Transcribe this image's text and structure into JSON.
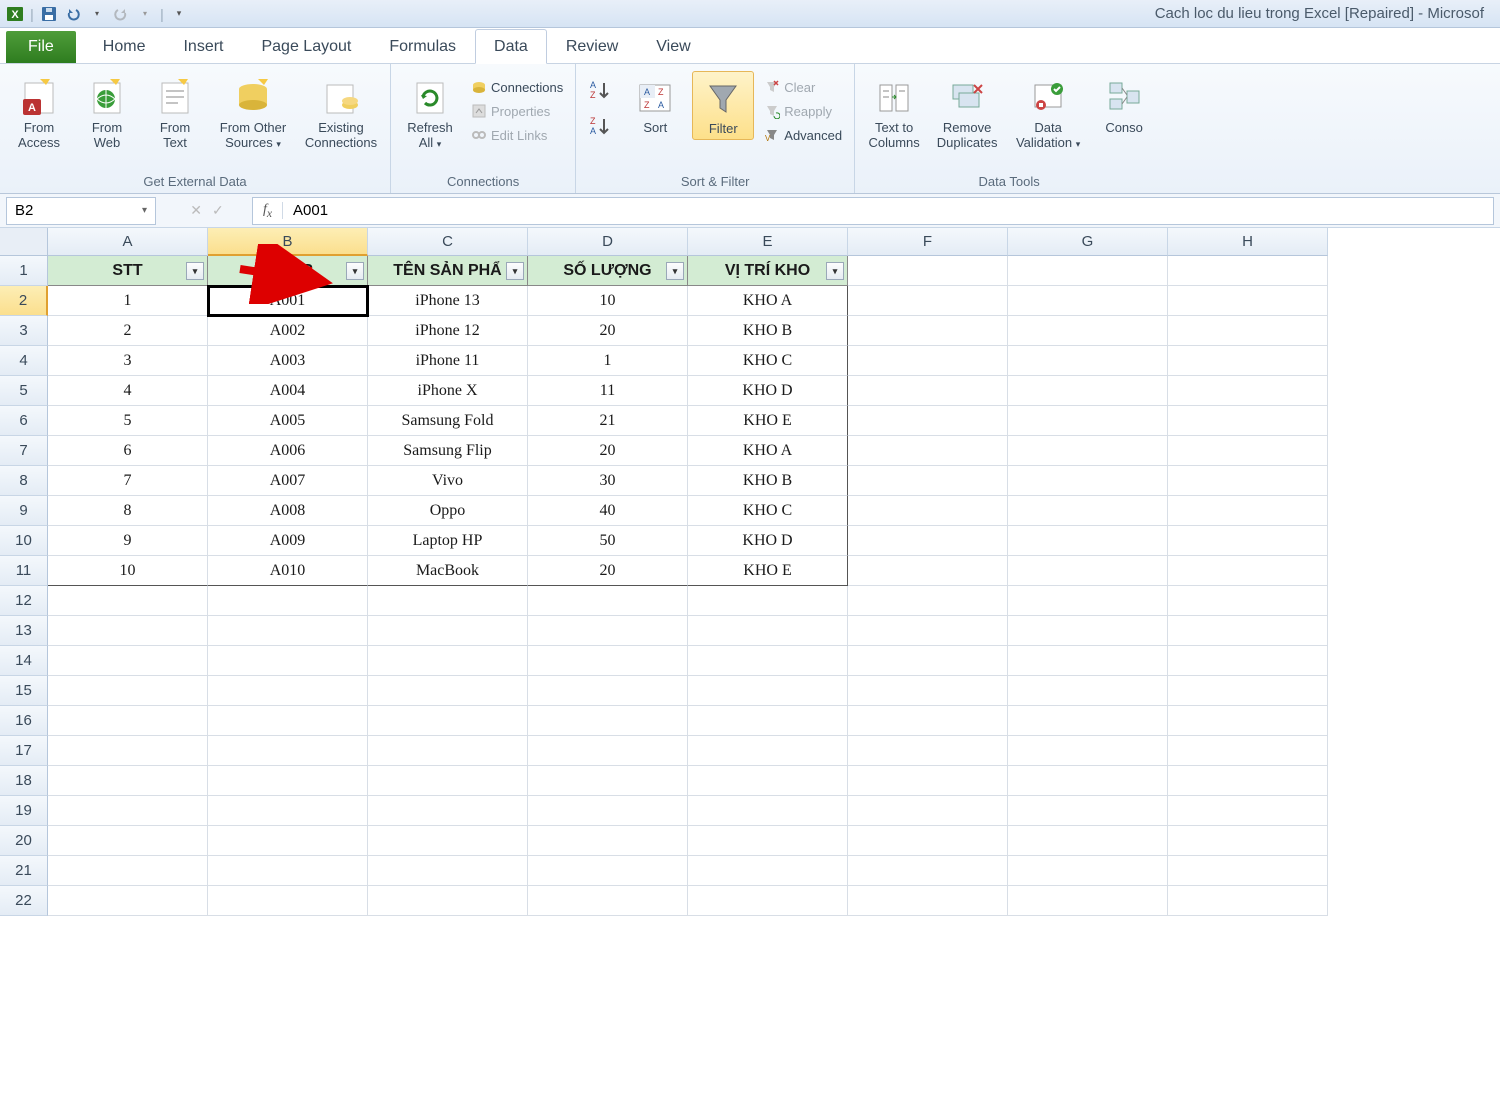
{
  "window_title": "Cach loc du lieu trong Excel [Repaired]  -  Microsof",
  "tabs": {
    "file": "File",
    "home": "Home",
    "insert": "Insert",
    "page_layout": "Page Layout",
    "formulas": "Formulas",
    "data": "Data",
    "review": "Review",
    "view": "View"
  },
  "ribbon": {
    "get_external": {
      "label": "Get External Data",
      "from_access": "From\nAccess",
      "from_web": "From\nWeb",
      "from_text": "From\nText",
      "from_other": "From Other\nSources",
      "existing": "Existing\nConnections"
    },
    "connections": {
      "label": "Connections",
      "refresh": "Refresh\nAll",
      "connections": "Connections",
      "properties": "Properties",
      "edit_links": "Edit Links"
    },
    "sort_filter": {
      "label": "Sort & Filter",
      "sort": "Sort",
      "filter": "Filter",
      "clear": "Clear",
      "reapply": "Reapply",
      "advanced": "Advanced"
    },
    "data_tools": {
      "label": "Data Tools",
      "text_to_cols": "Text to\nColumns",
      "remove_dup": "Remove\nDuplicates",
      "data_val": "Data\nValidation",
      "conso": "Conso"
    }
  },
  "namebox": "B2",
  "formula": "A001",
  "columns": [
    "A",
    "B",
    "C",
    "D",
    "E",
    "F",
    "G",
    "H"
  ],
  "selected_col_index": 1,
  "selected_row_index": 1,
  "visible_rows": 22,
  "table": {
    "headers": [
      "STT",
      "MÃ SP",
      "TÊN SẢN PHẨ",
      "SỐ LƯỢNG",
      "VỊ TRÍ KHO"
    ],
    "rows": [
      [
        "1",
        "A001",
        "iPhone 13",
        "10",
        "KHO A"
      ],
      [
        "2",
        "A002",
        "iPhone 12",
        "20",
        "KHO B"
      ],
      [
        "3",
        "A003",
        "iPhone 11",
        "1",
        "KHO C"
      ],
      [
        "4",
        "A004",
        "iPhone X",
        "11",
        "KHO D"
      ],
      [
        "5",
        "A005",
        "Samsung Fold",
        "21",
        "KHO E"
      ],
      [
        "6",
        "A006",
        "Samsung Flip",
        "20",
        "KHO A"
      ],
      [
        "7",
        "A007",
        "Vivo",
        "30",
        "KHO B"
      ],
      [
        "8",
        "A008",
        "Oppo",
        "40",
        "KHO C"
      ],
      [
        "9",
        "A009",
        "Laptop HP",
        "50",
        "KHO D"
      ],
      [
        "10",
        "A010",
        "MacBook",
        "20",
        "KHO E"
      ]
    ]
  }
}
